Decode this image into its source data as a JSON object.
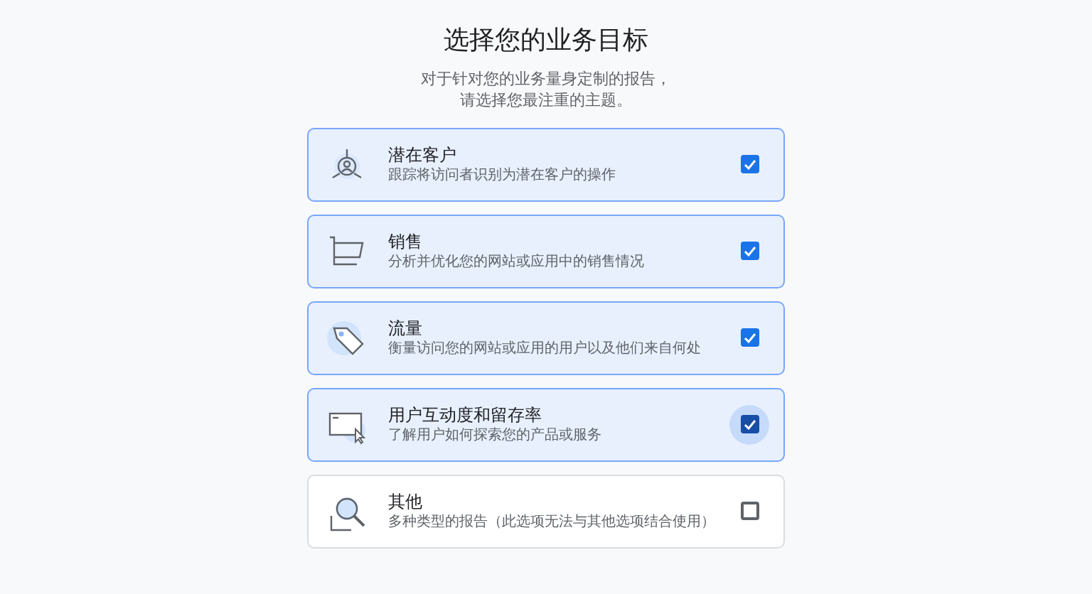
{
  "title": "选择您的业务目标",
  "subtitle_lines": [
    "对于针对您的业务量身定制的报告，",
    "请选择您最注重的主题。"
  ],
  "options": [
    {
      "kind": "leads",
      "label": "潜在客户",
      "description": "跟踪将访问者识别为潜在客户的操作",
      "checked": true,
      "focused": false
    },
    {
      "kind": "sales",
      "label": "销售",
      "description": "分析并优化您的网站或应用中的销售情况",
      "checked": true,
      "focused": false
    },
    {
      "kind": "traffic",
      "label": "流量",
      "description": "衡量访问您的网站或应用的用户以及他们来自何处",
      "checked": true,
      "focused": false
    },
    {
      "kind": "engagement",
      "label": "用户互动度和留存率",
      "description": "了解用户如何探索您的产品或服务",
      "checked": true,
      "focused": true
    },
    {
      "kind": "other",
      "label": "其他",
      "description": "多种类型的报告（此选项无法与其他选项结合使用）",
      "checked": false,
      "focused": false
    }
  ]
}
